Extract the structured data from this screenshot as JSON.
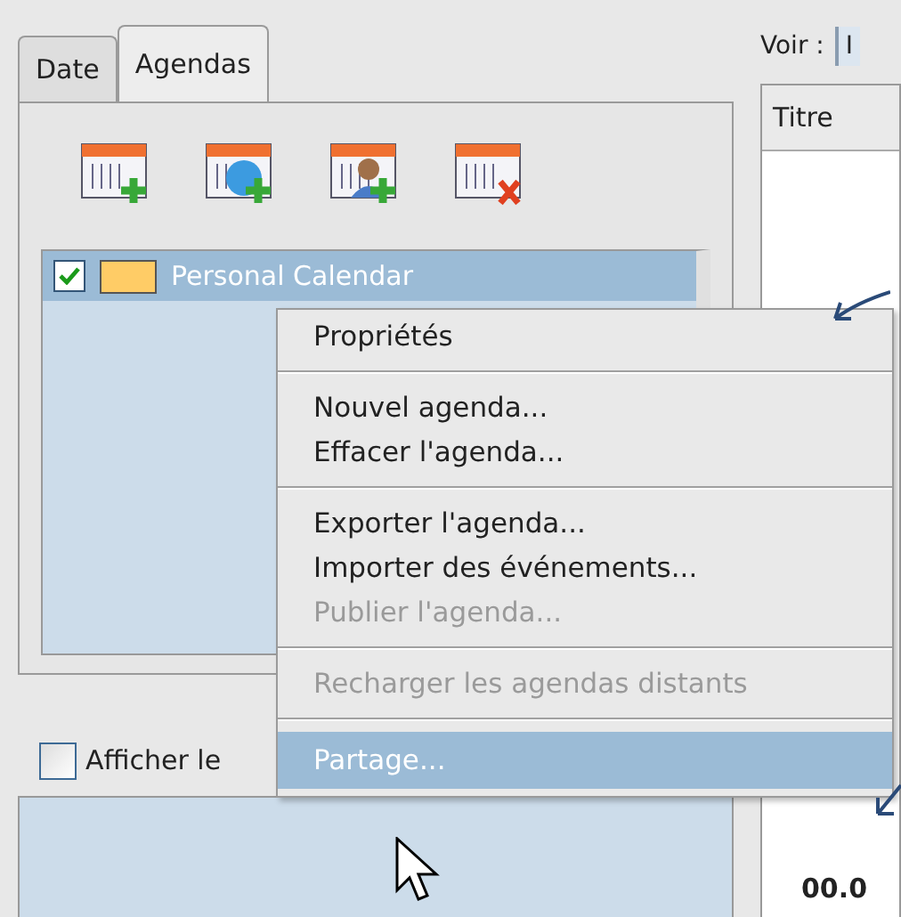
{
  "tabs": [
    {
      "label": "Date",
      "selected": false
    },
    {
      "label": "Agendas",
      "selected": true
    }
  ],
  "calendars": [
    {
      "name": "Personal Calendar",
      "checked": true,
      "color": "#ffcc66",
      "selected": true
    }
  ],
  "show_option": {
    "label": "Afficher le",
    "checked": false
  },
  "view": {
    "label": "Voir :",
    "button": "I"
  },
  "table": {
    "columns": [
      "Titre"
    ],
    "cell": "00.0"
  },
  "context_menu": [
    {
      "kind": "item",
      "label": "Propriétés",
      "disabled": false,
      "selected": false
    },
    {
      "kind": "separator"
    },
    {
      "kind": "item",
      "label": "Nouvel agenda...",
      "disabled": false,
      "selected": false
    },
    {
      "kind": "item",
      "label": "Effacer l'agenda...",
      "disabled": false,
      "selected": false
    },
    {
      "kind": "separator"
    },
    {
      "kind": "item",
      "label": "Exporter l'agenda...",
      "disabled": false,
      "selected": false
    },
    {
      "kind": "item",
      "label": "Importer des événements...",
      "disabled": false,
      "selected": false
    },
    {
      "kind": "item",
      "label": "Publier l'agenda...",
      "disabled": true,
      "selected": false
    },
    {
      "kind": "separator"
    },
    {
      "kind": "item",
      "label": "Recharger les agendas distants",
      "disabled": true,
      "selected": false
    },
    {
      "kind": "separator"
    },
    {
      "kind": "item",
      "label": "Partage...",
      "disabled": false,
      "selected": true
    }
  ]
}
